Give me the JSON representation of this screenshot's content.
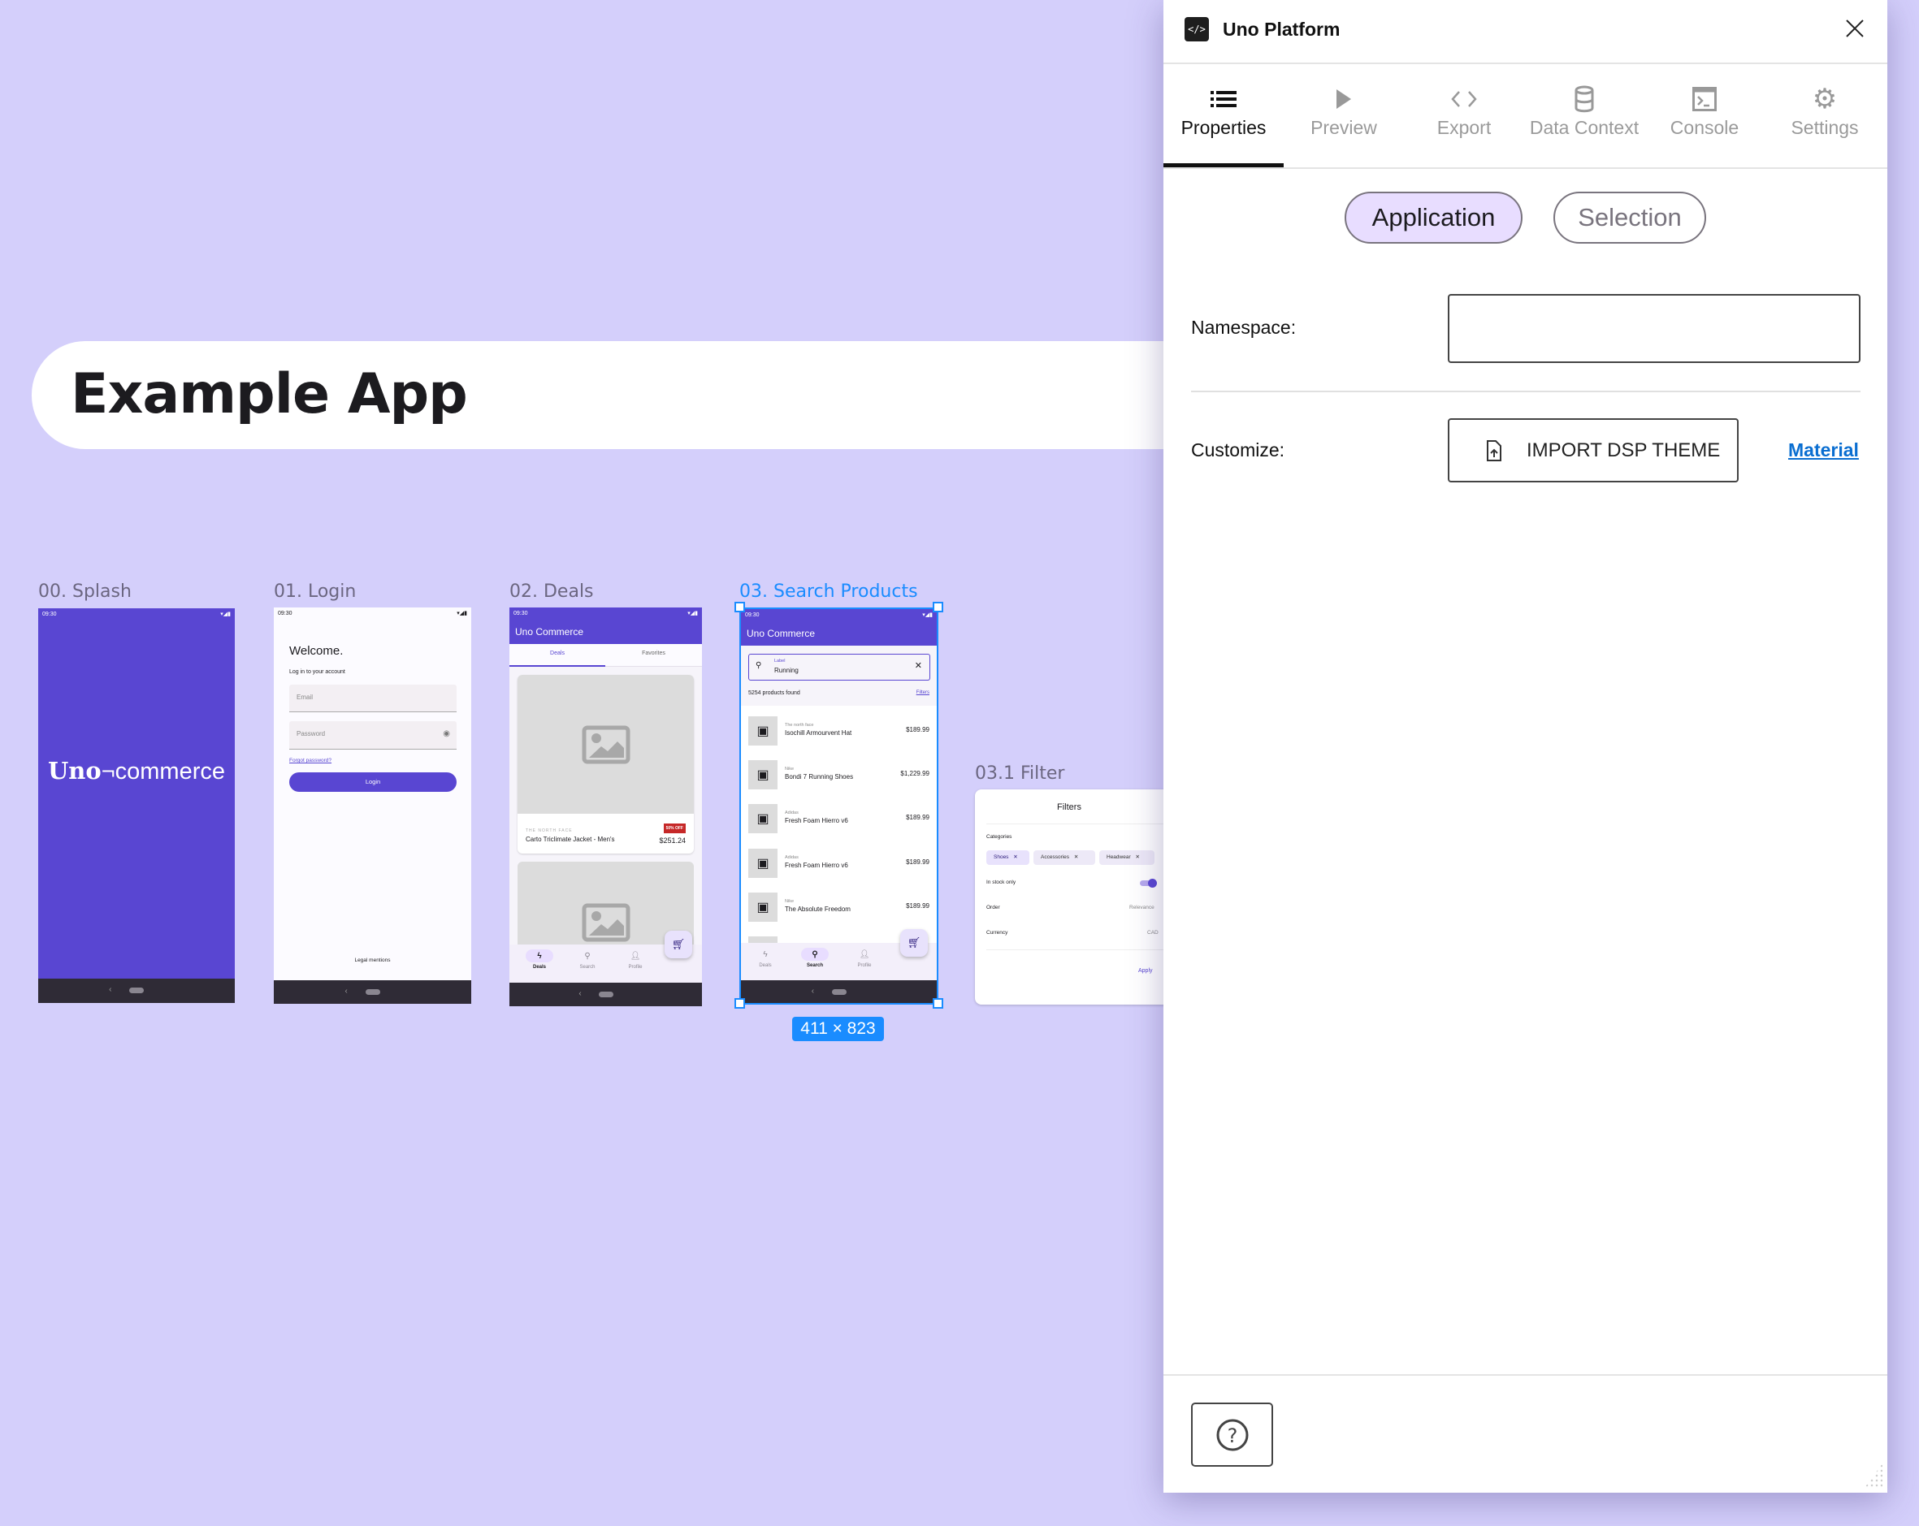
{
  "canvas": {
    "banner_title": "Example App",
    "frames": [
      "00. Splash",
      "01. Login",
      "02. Deals",
      "03. Search Products",
      "03.1 Filter"
    ],
    "selection_size": "411 × 823",
    "selection_color": "#1a8cff",
    "background": "#d4cffb"
  },
  "status_bar": {
    "time": "09:30"
  },
  "splash": {
    "logo_bold": "Uno",
    "logo_rest": "¬commerce",
    "color": "#5946d2"
  },
  "login": {
    "welcome": "Welcome.",
    "subtitle": "Log in to your account",
    "email_placeholder": "Email",
    "password_placeholder": "Password",
    "forgot": "Forgot password?",
    "login_button": "Login",
    "legal": "Legal mentions"
  },
  "deals": {
    "app_title": "Uno Commerce",
    "tabs": [
      "Deals",
      "Favorites"
    ],
    "card": {
      "brand": "THE NORTH FACE",
      "name": "Carto Triclimate Jacket - Men's",
      "badge": "50% OFF",
      "price": "$251.24"
    }
  },
  "nav": [
    "Deals",
    "Search",
    "Profile"
  ],
  "search": {
    "app_title": "Uno Commerce",
    "field_label": "Label",
    "field_value": "Running",
    "count": "5254 products found",
    "filters_link": "Filters",
    "items": [
      {
        "brand": "The north face",
        "name": "Isochill Armourvent Hat",
        "price": "$189.99"
      },
      {
        "brand": "Nike",
        "name": "Bondi 7 Running Shoes",
        "price": "$1,229.99"
      },
      {
        "brand": "Adidas",
        "name": "Fresh Foam Hierro v6",
        "price": "$189.99"
      },
      {
        "brand": "Adidas",
        "name": "Fresh Foam Hierro v6",
        "price": "$189.99"
      },
      {
        "brand": "Nike",
        "name": "The Absolute Freedom",
        "price": "$189.99"
      }
    ]
  },
  "filter": {
    "title": "Filters",
    "categories_label": "Categories",
    "chips": [
      "Shoes",
      "Accessories",
      "Headwear"
    ],
    "in_stock_label": "In stock only",
    "in_stock": true,
    "order_label": "Order",
    "order_value": "Relevance",
    "currency_label": "Currency",
    "currency_value": "CAD",
    "apply": "Apply"
  },
  "panel": {
    "title": "Uno Platform",
    "tabs": [
      "Properties",
      "Preview",
      "Export",
      "Data Context",
      "Console",
      "Settings"
    ],
    "active_tab": "Properties",
    "scope": [
      "Application",
      "Selection"
    ],
    "active_scope": "Application",
    "namespace_label": "Namespace:",
    "namespace_value": "",
    "customize_label": "Customize:",
    "import_button": "IMPORT DSP THEME",
    "material_link": "Material",
    "link_color": "#0a6ed1"
  }
}
